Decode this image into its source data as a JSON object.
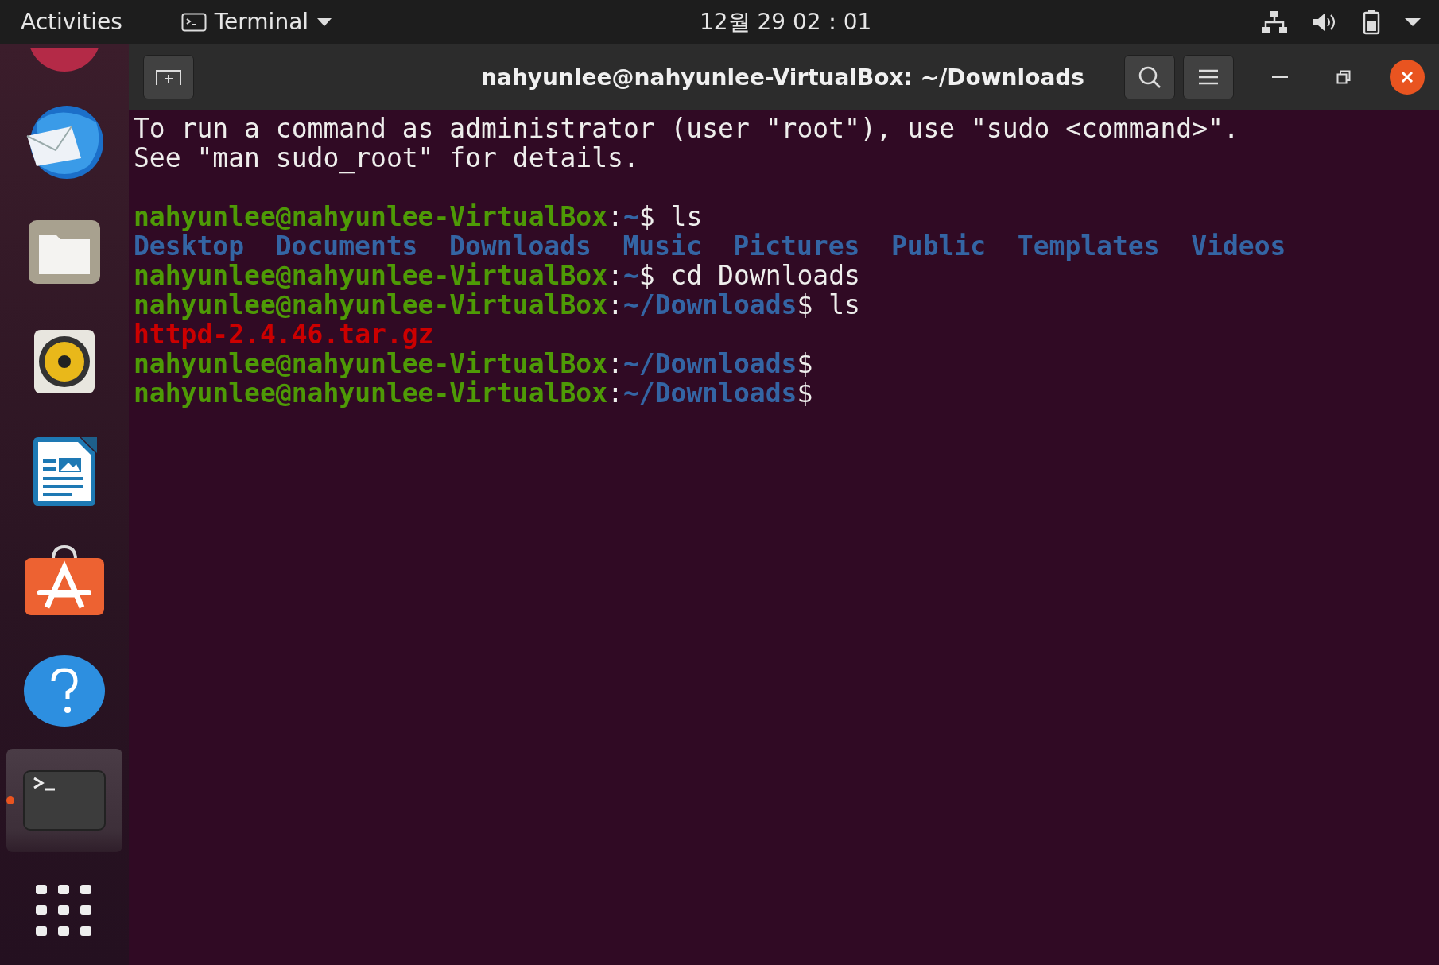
{
  "top_bar": {
    "activities": "Activities",
    "app_menu": {
      "label": "Terminal"
    },
    "clock": "12월 29  02：01"
  },
  "dock": {
    "items": [
      {
        "kind": "partial",
        "selected": false,
        "running": false
      },
      {
        "kind": "mail",
        "selected": false,
        "running": false
      },
      {
        "kind": "files",
        "selected": false,
        "running": false
      },
      {
        "kind": "music",
        "selected": false,
        "running": false
      },
      {
        "kind": "writer",
        "selected": false,
        "running": false
      },
      {
        "kind": "store",
        "selected": false,
        "running": false
      },
      {
        "kind": "help",
        "selected": false,
        "running": false
      },
      {
        "kind": "terminal",
        "selected": true,
        "running": true
      },
      {
        "kind": "grid",
        "selected": false,
        "running": false
      }
    ]
  },
  "window": {
    "title": "nahyunlee@nahyunlee-VirtualBox: ~/Downloads"
  },
  "terminal": {
    "motd": [
      "To run a command as administrator (user \"root\"), use \"sudo <command>\".",
      "See \"man sudo_root\" for details."
    ],
    "lines": [
      {
        "kind": "text",
        "segments": [
          {
            "text": "nahyunlee@nahyunlee-VirtualBox",
            "kind": "user"
          },
          {
            "text": ":",
            "kind": "plain"
          },
          {
            "text": "~",
            "kind": "path"
          },
          {
            "text": "$ ls",
            "kind": "plain"
          }
        ]
      },
      {
        "kind": "listing",
        "segments": [
          {
            "text": "Desktop",
            "kind": "dir"
          },
          {
            "text": "Documents",
            "kind": "dir"
          },
          {
            "text": "Downloads",
            "kind": "dir"
          },
          {
            "text": "Music",
            "kind": "dir"
          },
          {
            "text": "Pictures",
            "kind": "dir"
          },
          {
            "text": "Public",
            "kind": "dir"
          },
          {
            "text": "Templates",
            "kind": "dir"
          },
          {
            "text": "Videos",
            "kind": "dir"
          }
        ]
      },
      {
        "kind": "text",
        "segments": [
          {
            "text": "nahyunlee@nahyunlee-VirtualBox",
            "kind": "user"
          },
          {
            "text": ":",
            "kind": "plain"
          },
          {
            "text": "~",
            "kind": "path"
          },
          {
            "text": "$ cd Downloads",
            "kind": "plain"
          }
        ]
      },
      {
        "kind": "text",
        "segments": [
          {
            "text": "nahyunlee@nahyunlee-VirtualBox",
            "kind": "user"
          },
          {
            "text": ":",
            "kind": "plain"
          },
          {
            "text": "~/Downloads",
            "kind": "path"
          },
          {
            "text": "$ ls",
            "kind": "plain"
          }
        ]
      },
      {
        "kind": "listing",
        "segments": [
          {
            "text": "httpd-2.4.46.tar.gz",
            "kind": "archive"
          }
        ]
      },
      {
        "kind": "text",
        "segments": [
          {
            "text": "nahyunlee@nahyunlee-VirtualBox",
            "kind": "user"
          },
          {
            "text": ":",
            "kind": "plain"
          },
          {
            "text": "~/Downloads",
            "kind": "path"
          },
          {
            "text": "$",
            "kind": "plain"
          }
        ]
      },
      {
        "kind": "text",
        "segments": [
          {
            "text": "nahyunlee@nahyunlee-VirtualBox",
            "kind": "user"
          },
          {
            "text": ":",
            "kind": "plain"
          },
          {
            "text": "~/Downloads",
            "kind": "path"
          },
          {
            "text": "$",
            "kind": "plain"
          }
        ]
      }
    ]
  }
}
